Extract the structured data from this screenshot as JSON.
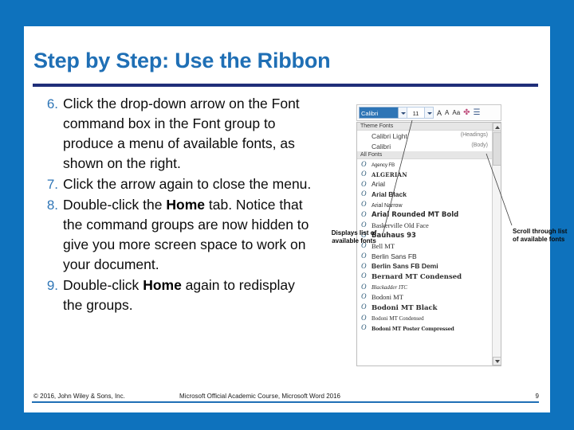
{
  "slide": {
    "title": "Step by Step: Use the Ribbon",
    "accent_color": "#1F6FB5",
    "rule_color": "#1F2E79",
    "background_color": "#0E72BD"
  },
  "steps": [
    {
      "num": "6.",
      "text_before": "Click the drop-down arrow on the Font command box in the Font group to produce a menu of available fonts, as shown on the right.",
      "bold": "",
      "text_after": ""
    },
    {
      "num": "7.",
      "text_before": "Click the arrow again to close the menu.",
      "bold": "",
      "text_after": ""
    },
    {
      "num": "8.",
      "text_before": "Double-click the ",
      "bold": "Home",
      "text_after": " tab. Notice that the command groups are now hidden to give you more screen space to work on your document."
    },
    {
      "num": "9.",
      "text_before": "Double-click ",
      "bold": "Home",
      "text_after": " again to redisplay the groups."
    }
  ],
  "word_graphic": {
    "toolbar": {
      "font_name": "Calibri",
      "font_size": "11",
      "grow_font": "A",
      "shrink_font": "A",
      "change_case": "Aa",
      "clear_formatting": "✤",
      "list_icon": "☰"
    },
    "dropdown": {
      "theme_section_label": "Theme Fonts",
      "theme_fonts": [
        {
          "name": "Calibri Light",
          "tag": "(Headings)"
        },
        {
          "name": "Calibri",
          "tag": "(Body)"
        }
      ],
      "all_section_label": "All Fonts",
      "all_fonts": [
        "Agency FB",
        "ALGERIAN",
        "Arial",
        "Arial Black",
        "Arial Narrow",
        "Arial Rounded MT Bold",
        "Baskerville Old Face",
        "Bauhaus 93",
        "Bell MT",
        "Berlin Sans FB",
        "Berlin Sans FB Demi",
        "Bernard MT Condensed",
        "Blackadder ITC",
        "Bodoni MT",
        "Bodoni MT Black",
        "Bodoni MT Condensed",
        "Bodoni MT Poster Compressed"
      ]
    }
  },
  "callouts": {
    "left": "Displays list of available fonts",
    "right": "Scroll through list of available fonts"
  },
  "footer": {
    "copyright": "© 2016, John Wiley & Sons, Inc.",
    "course": "Microsoft Official Academic Course, Microsoft Word 2016",
    "page": "9"
  }
}
